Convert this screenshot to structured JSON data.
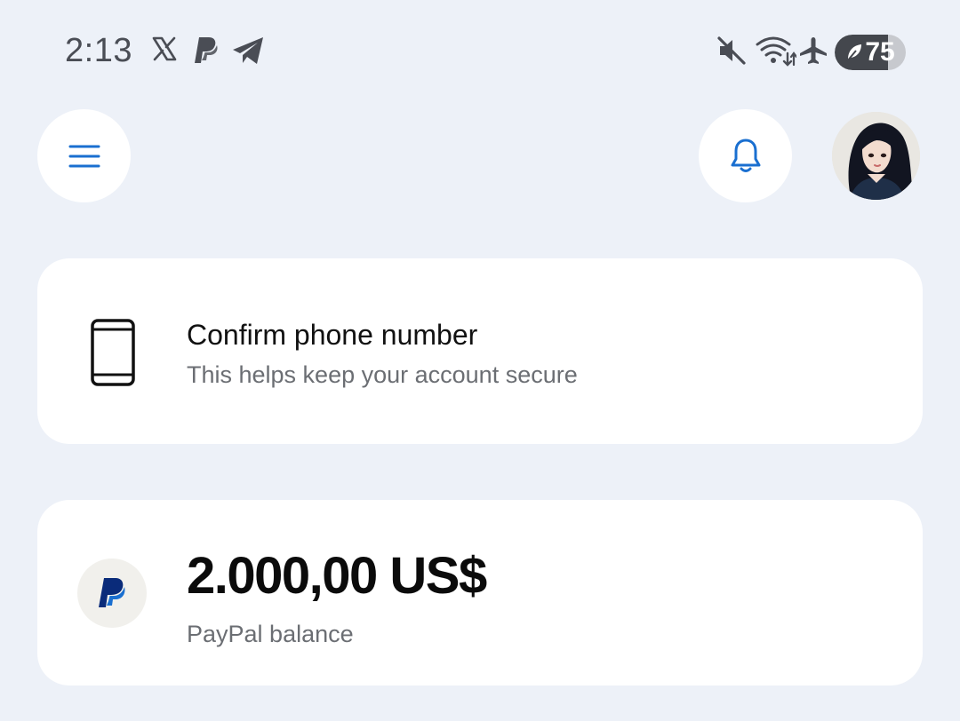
{
  "status_bar": {
    "time": "2:13",
    "notification_icons": [
      "x-logo-icon",
      "paypal-logo-icon",
      "telegram-icon"
    ],
    "system_icons": [
      "muted-icon",
      "wifi-icon",
      "airplane-mode-icon"
    ],
    "battery_level": "75",
    "battery_fraction": 0.75
  },
  "header": {
    "menu_icon": "hamburger-menu-icon",
    "notifications_icon": "bell-icon",
    "accent_color": "#1a6fd0"
  },
  "phone_card": {
    "icon": "smartphone-icon",
    "title": "Confirm phone number",
    "subtitle": "This helps keep your account secure"
  },
  "balance_card": {
    "icon": "paypal-logo-icon",
    "amount": "2.000,00 US$",
    "label": "PayPal balance"
  }
}
